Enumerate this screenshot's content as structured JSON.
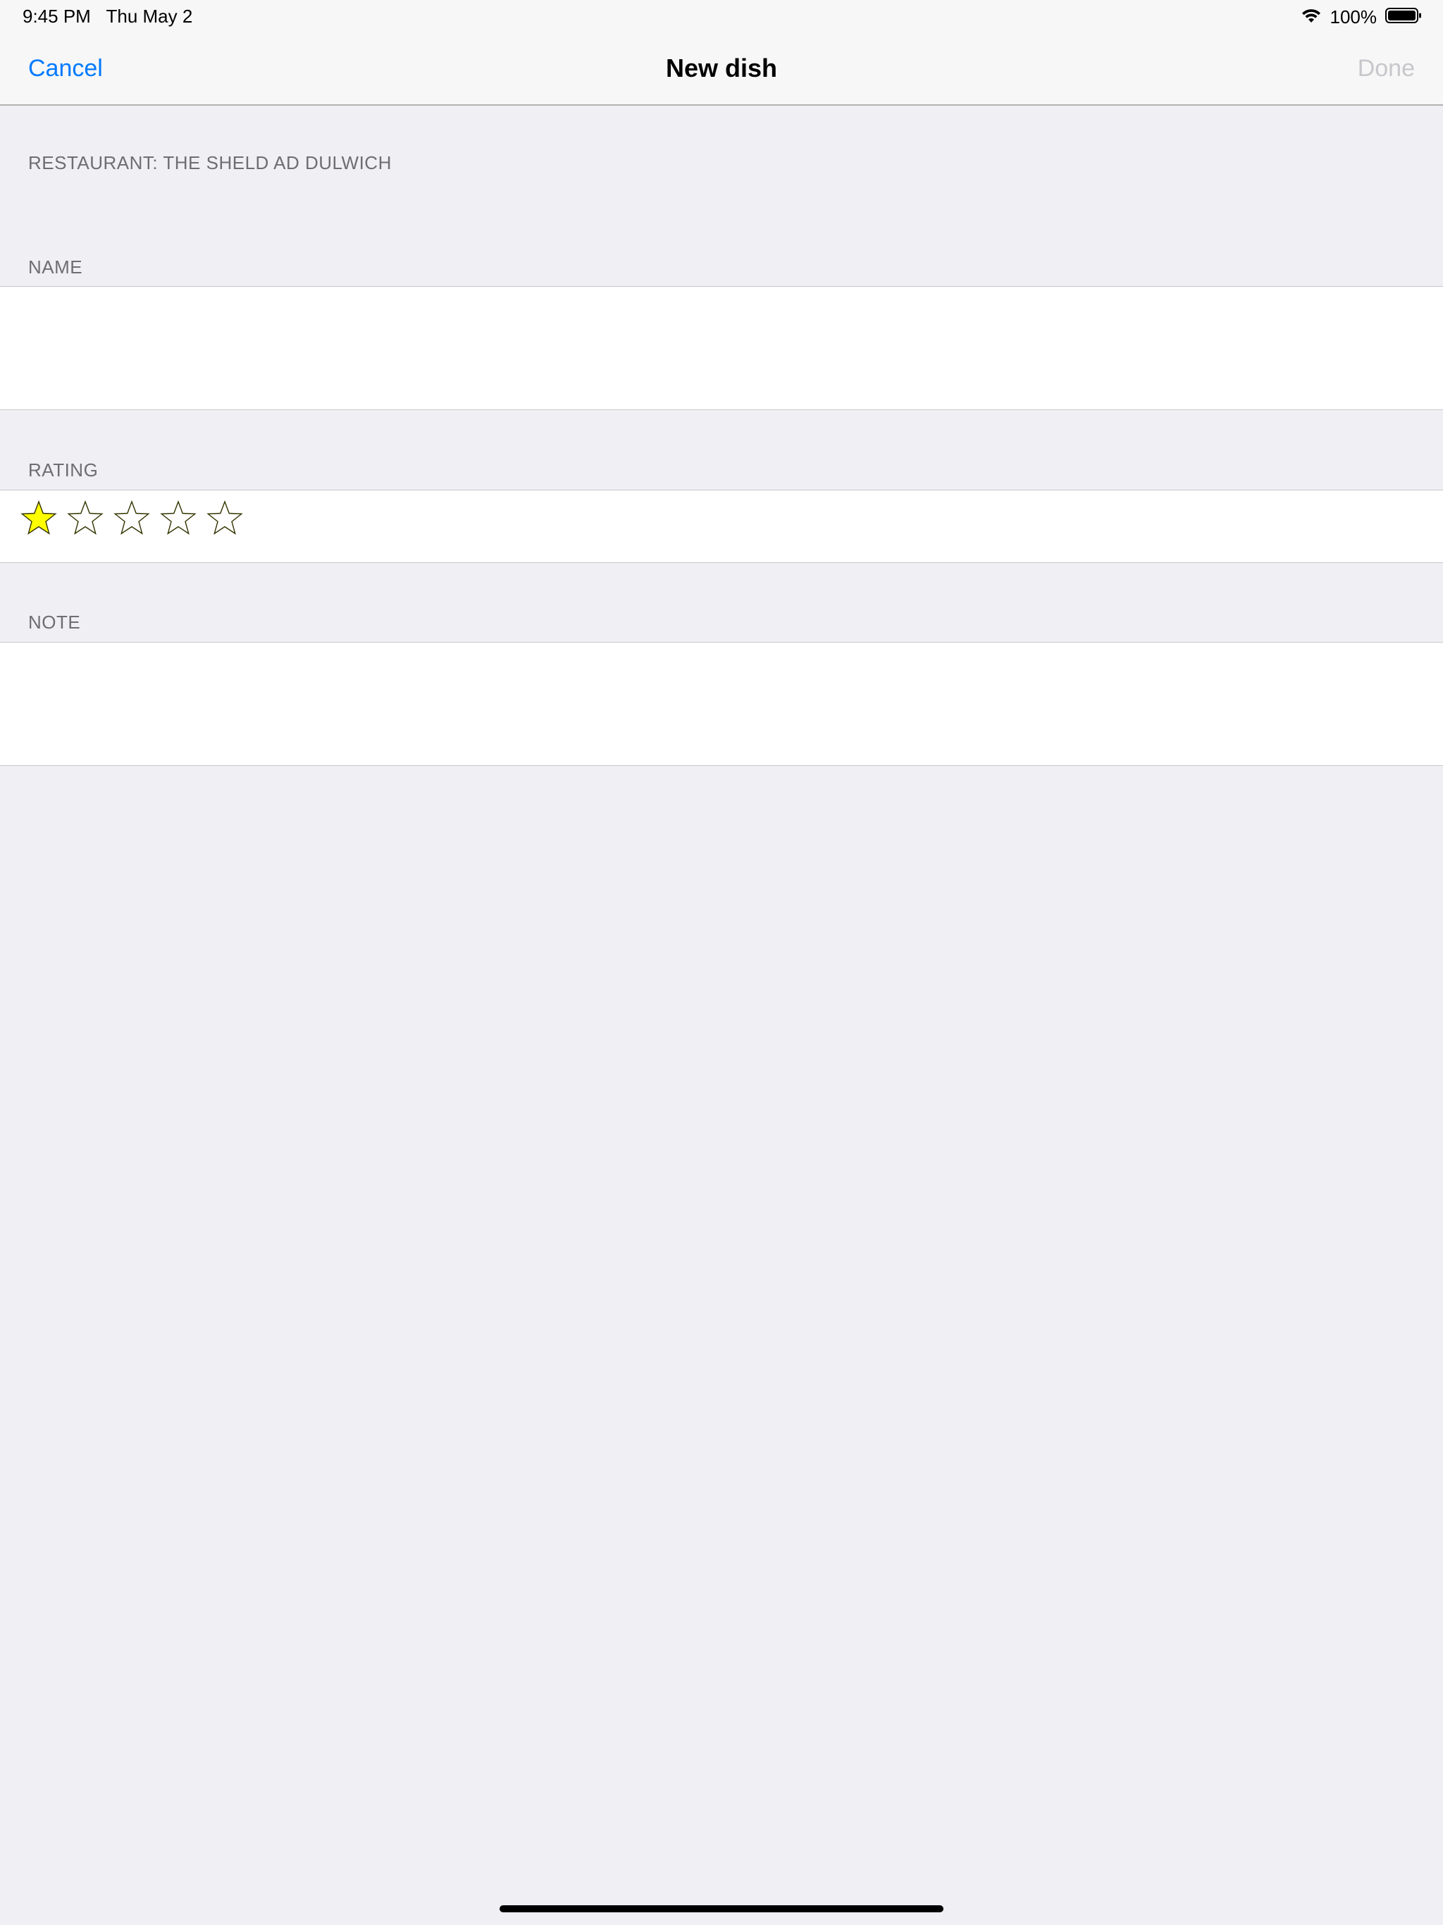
{
  "status_bar": {
    "time": "9:45 PM",
    "date": "Thu May 2",
    "battery_percent": "100%",
    "wifi_icon": "wifi-icon",
    "battery_icon": "battery-icon",
    "battery_level": 1.0
  },
  "navbar": {
    "cancel_label": "Cancel",
    "title": "New dish",
    "done_label": "Done",
    "accent_color": "#007aff",
    "disabled_color": "#c7c7cc"
  },
  "form": {
    "restaurant_label": "RESTAURANT: THE SHELD AD DULWICH",
    "name_label": "NAME",
    "name_value": "",
    "rating_label": "RATING",
    "rating": {
      "value": 1,
      "max": 5,
      "filled_color": "#ffff00",
      "empty_color": "#ffffff",
      "star_icon": "star-icon"
    },
    "note_label": "NOTE",
    "note_value": ""
  }
}
